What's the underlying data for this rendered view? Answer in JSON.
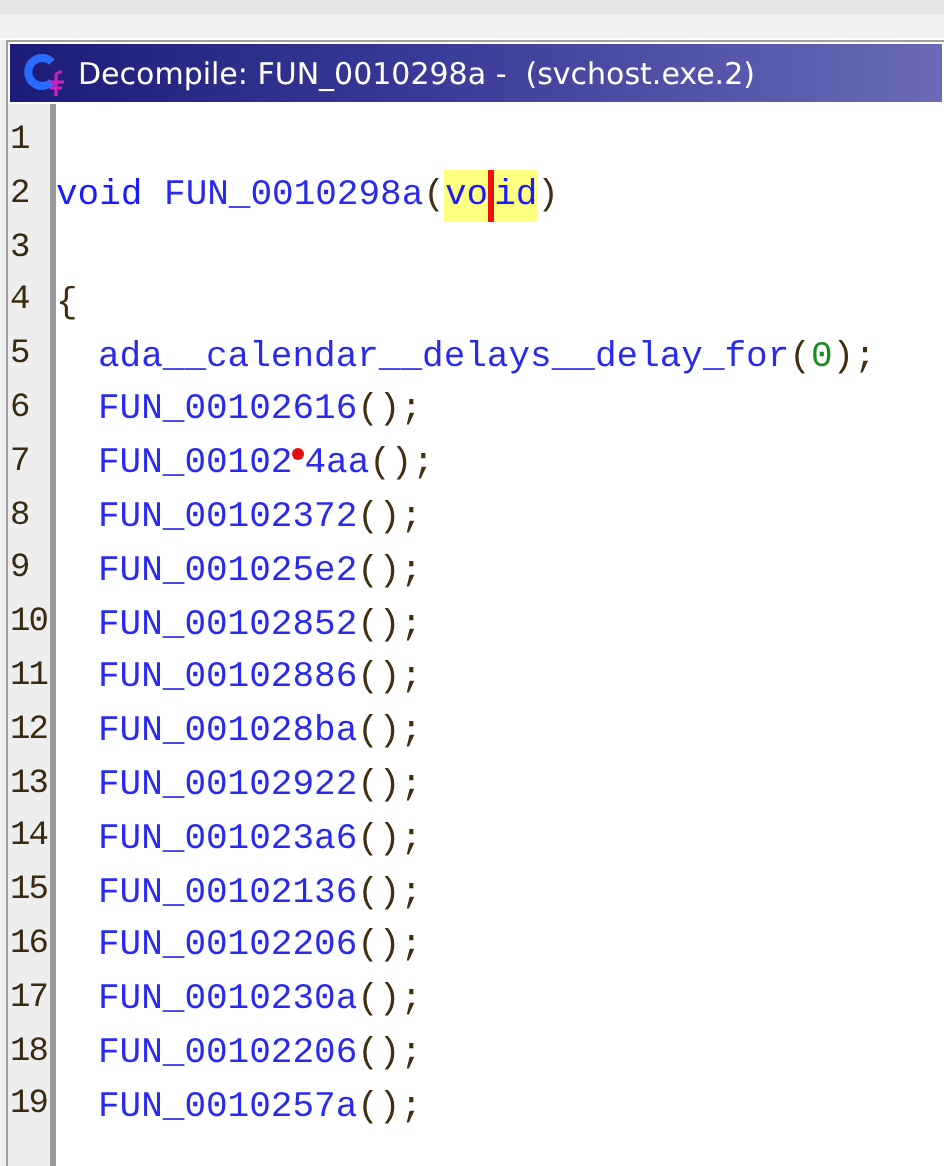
{
  "window": {
    "title": "Decompile: FUN_0010298a -  (svchost.exe.2)"
  },
  "lines": [
    {
      "number": "1"
    },
    {
      "number": "2",
      "indented": false,
      "tokens": [
        {
          "text": "void ",
          "kind": "keyword",
          "highlighted": false
        },
        {
          "text": "FUN_0010298a",
          "kind": "function",
          "highlighted": false
        },
        {
          "text": "(",
          "kind": "punct",
          "highlighted": false
        },
        {
          "text": "vo",
          "kind": "keyword",
          "highlighted": true
        },
        {
          "kind": "cursor"
        },
        {
          "text": "id",
          "kind": "keyword",
          "highlighted": true
        },
        {
          "text": ")",
          "kind": "punct",
          "highlighted": false
        }
      ]
    },
    {
      "number": "3"
    },
    {
      "number": "4",
      "indented": false,
      "tokens": [
        {
          "text": "{",
          "kind": "punct",
          "highlighted": false
        }
      ]
    },
    {
      "number": "5",
      "indented": true,
      "tokens": [
        {
          "text": "ada__calendar__delays__delay_for",
          "kind": "function",
          "highlighted": false
        },
        {
          "text": "(",
          "kind": "punct",
          "highlighted": false
        },
        {
          "text": "0",
          "kind": "number",
          "highlighted": false
        },
        {
          "text": ");",
          "kind": "punct",
          "highlighted": false
        }
      ]
    },
    {
      "number": "6",
      "indented": true,
      "tokens": [
        {
          "text": "FUN_00102616",
          "kind": "function",
          "highlighted": false
        },
        {
          "text": "();",
          "kind": "punct",
          "highlighted": false
        }
      ]
    },
    {
      "number": "7",
      "indented": true,
      "tokens": [
        {
          "text": "FUN_00102",
          "kind": "function",
          "highlighted": false
        },
        {
          "kind": "dot"
        },
        {
          "text": "4aa",
          "kind": "function",
          "highlighted": false
        },
        {
          "text": "();",
          "kind": "punct",
          "highlighted": false
        }
      ]
    },
    {
      "number": "8",
      "indented": true,
      "tokens": [
        {
          "text": "FUN_00102372",
          "kind": "function",
          "highlighted": false
        },
        {
          "text": "();",
          "kind": "punct",
          "highlighted": false
        }
      ]
    },
    {
      "number": "9",
      "indented": true,
      "tokens": [
        {
          "text": "FUN_001025e2",
          "kind": "function",
          "highlighted": false
        },
        {
          "text": "();",
          "kind": "punct",
          "highlighted": false
        }
      ]
    },
    {
      "number": "10",
      "indented": true,
      "tokens": [
        {
          "text": "FUN_00102852",
          "kind": "function",
          "highlighted": false
        },
        {
          "text": "();",
          "kind": "punct",
          "highlighted": false
        }
      ]
    },
    {
      "number": "11",
      "indented": true,
      "tokens": [
        {
          "text": "FUN_00102886",
          "kind": "function",
          "highlighted": false
        },
        {
          "text": "();",
          "kind": "punct",
          "highlighted": false
        }
      ]
    },
    {
      "number": "12",
      "indented": true,
      "tokens": [
        {
          "text": "FUN_001028ba",
          "kind": "function",
          "highlighted": false
        },
        {
          "text": "();",
          "kind": "punct",
          "highlighted": false
        }
      ]
    },
    {
      "number": "13",
      "indented": true,
      "tokens": [
        {
          "text": "FUN_00102922",
          "kind": "function",
          "highlighted": false
        },
        {
          "text": "();",
          "kind": "punct",
          "highlighted": false
        }
      ]
    },
    {
      "number": "14",
      "indented": true,
      "tokens": [
        {
          "text": "FUN_001023a6",
          "kind": "function",
          "highlighted": false
        },
        {
          "text": "();",
          "kind": "punct",
          "highlighted": false
        }
      ]
    },
    {
      "number": "15",
      "indented": true,
      "tokens": [
        {
          "text": "FUN_00102136",
          "kind": "function",
          "highlighted": false
        },
        {
          "text": "();",
          "kind": "punct",
          "highlighted": false
        }
      ]
    },
    {
      "number": "16",
      "indented": true,
      "tokens": [
        {
          "text": "FUN_00102206",
          "kind": "function",
          "highlighted": false
        },
        {
          "text": "();",
          "kind": "punct",
          "highlighted": false
        }
      ]
    },
    {
      "number": "17",
      "indented": true,
      "tokens": [
        {
          "text": "FUN_0010230a",
          "kind": "function",
          "highlighted": false
        },
        {
          "text": "();",
          "kind": "punct",
          "highlighted": false
        }
      ]
    },
    {
      "number": "18",
      "indented": true,
      "tokens": [
        {
          "text": "FUN_00102206",
          "kind": "function",
          "highlighted": false
        },
        {
          "text": "();",
          "kind": "punct",
          "highlighted": false
        }
      ]
    },
    {
      "number": "19",
      "indented": true,
      "tokens": [
        {
          "text": "FUN_0010257a",
          "kind": "function",
          "highlighted": false
        },
        {
          "text": "();",
          "kind": "punct",
          "highlighted": false
        }
      ]
    }
  ]
}
